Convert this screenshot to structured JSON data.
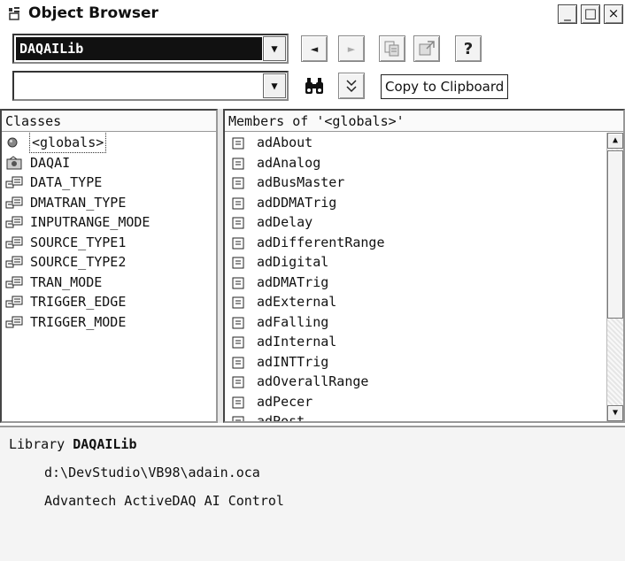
{
  "window": {
    "title": "Object Browser",
    "minimize": "_",
    "maximize": "□",
    "close": "×"
  },
  "toolbar": {
    "library_value": "DAQAILib",
    "search_value": "",
    "tooltip": "Copy to Clipboard",
    "back_icon": "◄",
    "forward_icon": "►",
    "help_icon": "?",
    "find_icon": "binoculars-icon",
    "toggle_icon": "≚"
  },
  "classes": {
    "header": "Classes",
    "items": [
      {
        "label": "<globals>",
        "icon": "globals-icon"
      },
      {
        "label": "DAQAI",
        "icon": "control-icon"
      },
      {
        "label": "DATA_TYPE",
        "icon": "enum-icon"
      },
      {
        "label": "DMATRAN_TYPE",
        "icon": "enum-icon"
      },
      {
        "label": "INPUTRANGE_MODE",
        "icon": "enum-icon"
      },
      {
        "label": "SOURCE_TYPE1",
        "icon": "enum-icon"
      },
      {
        "label": "SOURCE_TYPE2",
        "icon": "enum-icon"
      },
      {
        "label": "TRAN_MODE",
        "icon": "enum-icon"
      },
      {
        "label": "TRIGGER_EDGE",
        "icon": "enum-icon"
      },
      {
        "label": "TRIGGER_MODE",
        "icon": "enum-icon"
      }
    ]
  },
  "members": {
    "header": "Members of '<globals>'",
    "items": [
      "adAbout",
      "adAnalog",
      "adBusMaster",
      "adDDMATrig",
      "adDelay",
      "adDifferentRange",
      "adDigital",
      "adDMATrig",
      "adExternal",
      "adFalling",
      "adInternal",
      "adINTTrig",
      "adOverallRange",
      "adPecer",
      "adPost"
    ]
  },
  "details": {
    "prefix": "Library",
    "library_name": "DAQAILib",
    "path": "d:\\DevStudio\\VB98\\adain.oca",
    "description": "Advantech ActiveDAQ AI Control"
  }
}
